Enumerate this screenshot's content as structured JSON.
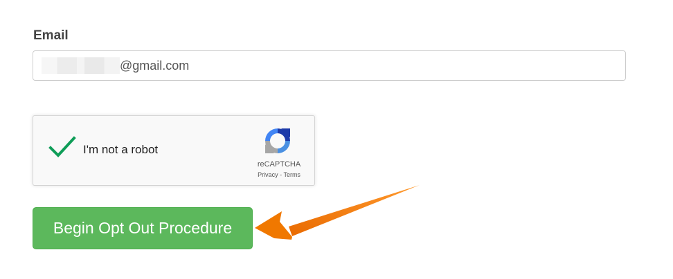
{
  "form": {
    "email_label": "Email",
    "email_value_visible": "@gmail.com"
  },
  "recaptcha": {
    "checkbox_label": "I'm not a robot",
    "checked": true,
    "brand": "reCAPTCHA",
    "privacy_link": "Privacy",
    "separator": "-",
    "terms_link": "Terms",
    "check_color": "#0f9d58"
  },
  "actions": {
    "begin_button_label": "Begin Opt Out Procedure",
    "button_color": "#5cb85c"
  },
  "annotation": {
    "arrow_color": "#f57c00",
    "arrow_icon": "pointer-arrow-icon"
  }
}
